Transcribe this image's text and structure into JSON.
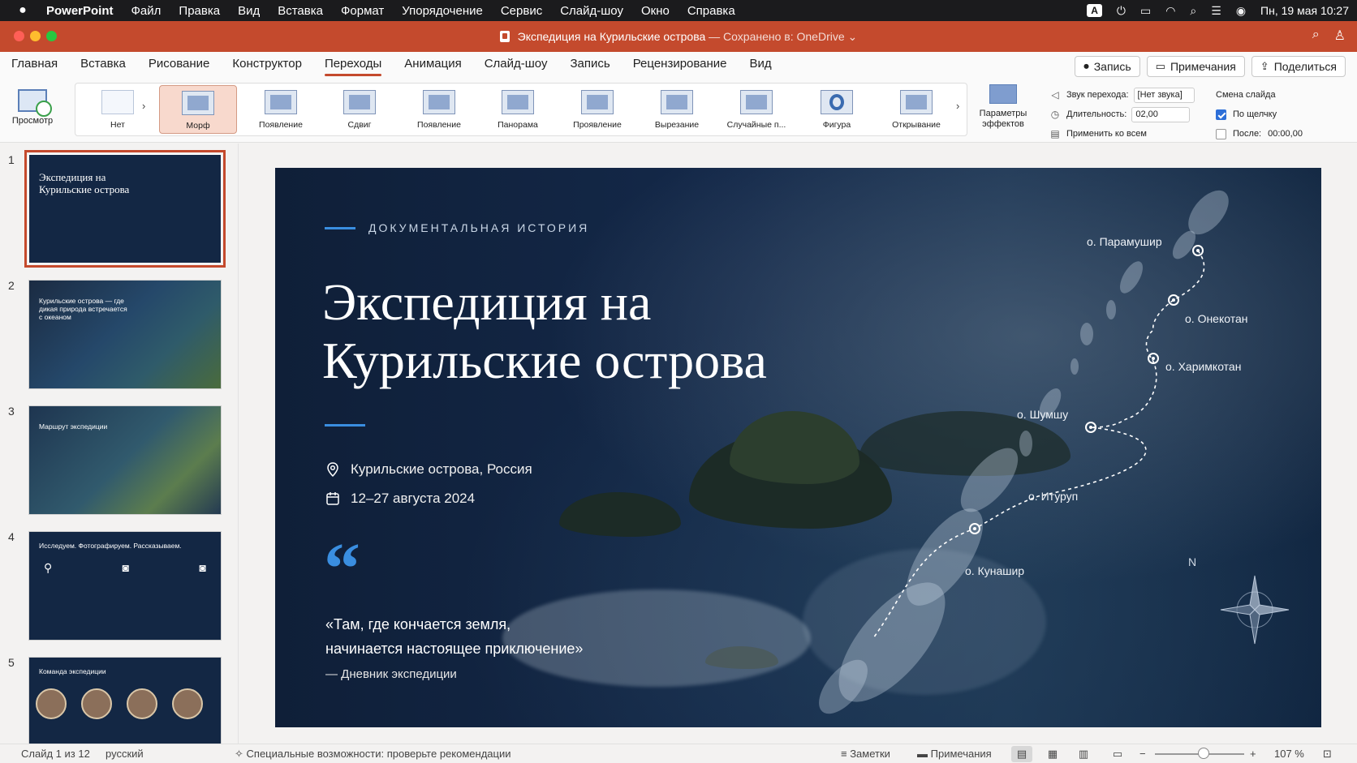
{
  "menubar": {
    "app": "PowerPoint",
    "items": [
      "Файл",
      "Правка",
      "Вид",
      "Вставка",
      "Формат",
      "Упорядочение",
      "Сервис",
      "Слайд-шоу",
      "Окно",
      "Справка"
    ],
    "input_source": "A",
    "datetime": "Пн, 19 мая  10:27"
  },
  "window": {
    "doc_name": "Экспедиция на Курильские острова",
    "save_status": "— Сохранено в: OneDrive"
  },
  "ribbon_tabs": [
    "Главная",
    "Вставка",
    "Рисование",
    "Конструктор",
    "Переходы",
    "Анимация",
    "Слайд-шоу",
    "Запись",
    "Рецензирование",
    "Вид"
  ],
  "active_tab": "Переходы",
  "tab_actions": {
    "record": "Запись",
    "comments": "Примечания",
    "share": "Поделиться"
  },
  "ribbon": {
    "preview": "Просмотр",
    "transitions": [
      "Нет",
      "Морф",
      "Появление",
      "Сдвиг",
      "Появление",
      "Панорама",
      "Проявление",
      "Вырезание",
      "Случайные п...",
      "Фигура",
      "Открывание"
    ],
    "selected_transition": "Морф",
    "effects_line1": "Параметры",
    "effects_line2": "эффектов",
    "sound_label": "Звук перехода:",
    "sound_value": "[Нет звука]",
    "duration_label": "Длительность:",
    "duration_value": "02,00",
    "apply_all": "Применить ко всем",
    "advance_title": "Смена слайда",
    "on_click_label": "По щелчку",
    "on_click_checked": true,
    "after_label": "После:",
    "after_checked": false,
    "after_value": "00:00,00"
  },
  "thumbnails": [
    {
      "num": "1",
      "title": "Экспедиция на Курильские острова"
    },
    {
      "num": "2",
      "title": "Курильские острова — где дикая природа встречается с океаном"
    },
    {
      "num": "3",
      "title": "Маршрут экспедиции"
    },
    {
      "num": "4",
      "title": "Исследуем. Фотографируем. Рассказываем."
    },
    {
      "num": "5",
      "title": "Команда экспедиции"
    }
  ],
  "slide": {
    "kicker": "ДОКУМЕНТАЛЬНАЯ ИСТОРИЯ",
    "title_line1": "Экспедиция на",
    "title_line2": "Курильские острова",
    "location": "Курильские острова, Россия",
    "dates": "12–27 августа 2024",
    "quote_line1": "«Там, где кончается земля,",
    "quote_line2": "начинается настоящее приключение»",
    "quote_source": "— Дневник экспедиции",
    "north": "N",
    "map_labels": [
      "о. Парамушир",
      "о. Онекотан",
      "о. Харимкотан",
      "о. Шумшу",
      "о. Итуруп",
      "о. Кунашир"
    ]
  },
  "statusbar": {
    "slide_of": "Слайд 1 из 12",
    "language": "русский",
    "accessibility": "Специальные возможности: проверьте рекомендации",
    "notes": "Заметки",
    "comments": "Примечания",
    "zoom": "107 %"
  },
  "colors": {
    "accent": "#c44a2d",
    "slide_accent": "#3a8ee0",
    "slide_bg": "#14294a"
  }
}
